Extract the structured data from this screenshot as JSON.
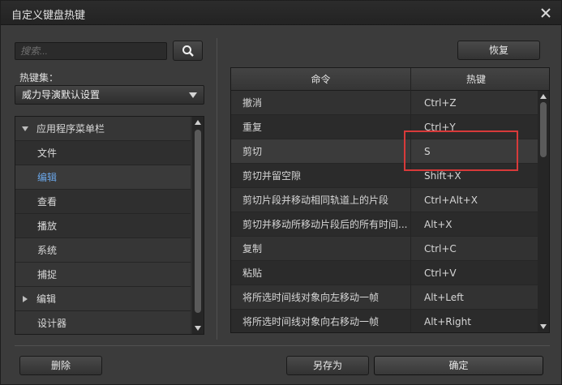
{
  "window": {
    "title": "自定义键盘热键"
  },
  "search": {
    "placeholder": "搜索..."
  },
  "keyset": {
    "label": "热键集：",
    "selected": "威力导演默认设置"
  },
  "tree": {
    "items": [
      {
        "label": "应用程序菜单栏",
        "type": "category",
        "expanded": true
      },
      {
        "label": "文件",
        "type": "child"
      },
      {
        "label": "编辑",
        "type": "child",
        "selected": true
      },
      {
        "label": "查看",
        "type": "child"
      },
      {
        "label": "播放",
        "type": "child"
      },
      {
        "label": "系统",
        "type": "category"
      },
      {
        "label": "捕捉",
        "type": "category"
      },
      {
        "label": "编辑",
        "type": "category",
        "collapsed": true
      },
      {
        "label": "设计器",
        "type": "category"
      }
    ]
  },
  "actions": {
    "restore": "恢复",
    "delete": "删除",
    "save_as": "另存为",
    "ok": "确定"
  },
  "table": {
    "headers": {
      "command": "命令",
      "hotkey": "热键"
    },
    "rows": [
      {
        "command": "撤消",
        "hotkey": "Ctrl+Z"
      },
      {
        "command": "重复",
        "hotkey": "Ctrl+Y"
      },
      {
        "command": "剪切",
        "hotkey": "S"
      },
      {
        "command": "剪切并留空隙",
        "hotkey": "Shift+X"
      },
      {
        "command": "剪切片段并移动相同轨道上的片段",
        "hotkey": "Ctrl+Alt+X"
      },
      {
        "command": "剪切并移动所移动片段后的所有时间...",
        "hotkey": "Alt+X"
      },
      {
        "command": "复制",
        "hotkey": "Ctrl+C"
      },
      {
        "command": "粘贴",
        "hotkey": "Ctrl+V"
      },
      {
        "command": "将所选时间线对象向左移动一帧",
        "hotkey": "Alt+Left"
      },
      {
        "command": "将所选时间线对象向右移动一帧",
        "hotkey": "Alt+Right"
      }
    ]
  },
  "colors": {
    "selected_text": "#6aa6e8",
    "highlight_box": "#d83a3a"
  }
}
